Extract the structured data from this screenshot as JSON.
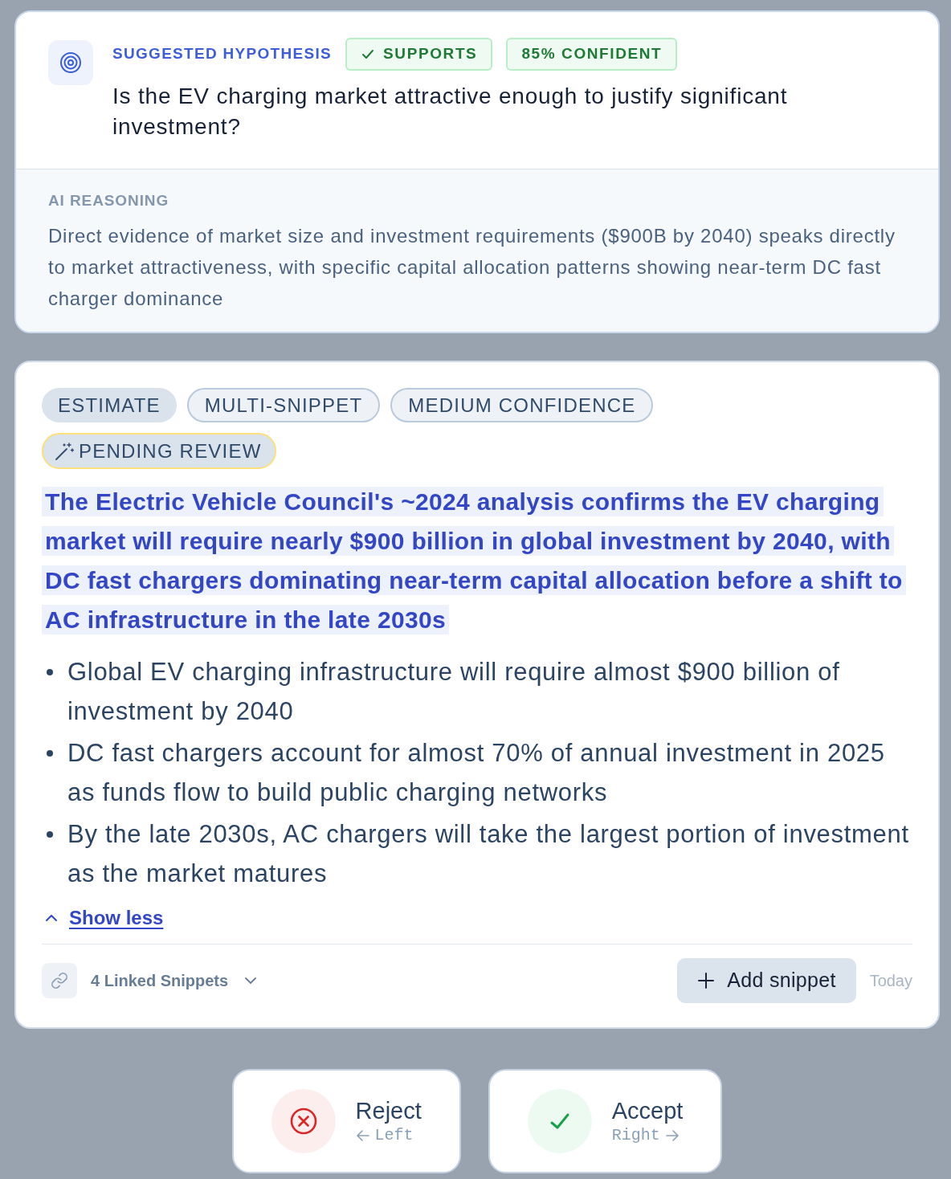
{
  "hypothesis": {
    "eyebrow": "SUGGESTED HYPOTHESIS",
    "badges": [
      {
        "kind": "stance",
        "label": "SUPPORTS"
      },
      {
        "kind": "confidence",
        "label": "85% CONFIDENT"
      }
    ],
    "question": "Is the EV charging market attractive enough to justify significant investment?",
    "reasoning": {
      "heading": "AI REASONING",
      "text": "Direct evidence of market size and investment requirements ($900B by 2040) speaks directly to market attractiveness, with specific capital allocation patterns showing near-term DC fast charger dominance"
    }
  },
  "snippet": {
    "tags": [
      {
        "kind": "filled",
        "label": "ESTIMATE"
      },
      {
        "kind": "outlined",
        "label": "MULTI-SNIPPET"
      },
      {
        "kind": "outlined",
        "label": "MEDIUM CONFIDENCE"
      },
      {
        "kind": "pending",
        "label": "PENDING REVIEW"
      }
    ],
    "claim": "The Electric Vehicle Council's ~2024 analysis confirms the EV charging market will require nearly $900 billion in global investment by 2040, with DC fast chargers dominating near-term capital allocation before a shift to AC infrastructure in the late 2030s",
    "bullets": [
      "Global EV charging infrastructure will require almost $900 billion of investment by 2040",
      "DC fast chargers account for almost 70% of annual investment in 2025 as funds flow to build public charging networks",
      "By the late 2030s, AC chargers will take the largest portion of investment as the market matures"
    ],
    "expanded": true,
    "toggle": "Show less",
    "linked": "4 Linked Snippets",
    "add_button": "Add snippet",
    "date": "Today"
  },
  "actions": [
    {
      "kind": "reject",
      "label": "Reject",
      "shortcut": "Left"
    },
    {
      "kind": "accept",
      "label": "Accept",
      "shortcut": "Right"
    }
  ]
}
